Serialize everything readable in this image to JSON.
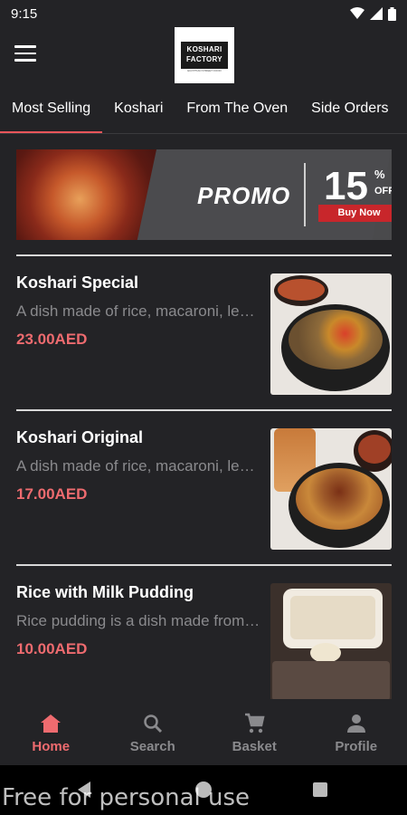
{
  "status": {
    "time": "9:15"
  },
  "header": {
    "logo_line1": "KOSHARI",
    "logo_line2": "FACTORY",
    "logo_tagline": "EGYPTIAN STREET FOOD"
  },
  "tabs": [
    {
      "label": "Most Selling",
      "active": true
    },
    {
      "label": "Koshari",
      "active": false
    },
    {
      "label": "From The Oven",
      "active": false
    },
    {
      "label": "Side Orders",
      "active": false
    }
  ],
  "promo": {
    "title": "PROMO",
    "percent": "15",
    "percent_sign": "%",
    "off": "OFF",
    "cta": "Buy Now"
  },
  "items": [
    {
      "name": "Koshari Special",
      "description": "A dish made of rice, macaroni, lentils and chickpeas",
      "price": "23.00AED"
    },
    {
      "name": "Koshari Original",
      "description": "A dish made of rice, macaroni, lentils and chickpeas",
      "price": "17.00AED"
    },
    {
      "name": "Rice with Milk Pudding",
      "description": "Rice pudding is a dish made from rice mixed with milk",
      "price": "10.00AED"
    }
  ],
  "nav": [
    {
      "label": "Home",
      "icon": "home-icon",
      "active": true
    },
    {
      "label": "Search",
      "icon": "search-icon",
      "active": false
    },
    {
      "label": "Basket",
      "icon": "cart-icon",
      "active": false
    },
    {
      "label": "Profile",
      "icon": "person-icon",
      "active": false
    }
  ],
  "colors": {
    "accent": "#ee6b6f",
    "background": "#232326",
    "promo_button": "#c8262b"
  },
  "watermark": "Free for personal use"
}
